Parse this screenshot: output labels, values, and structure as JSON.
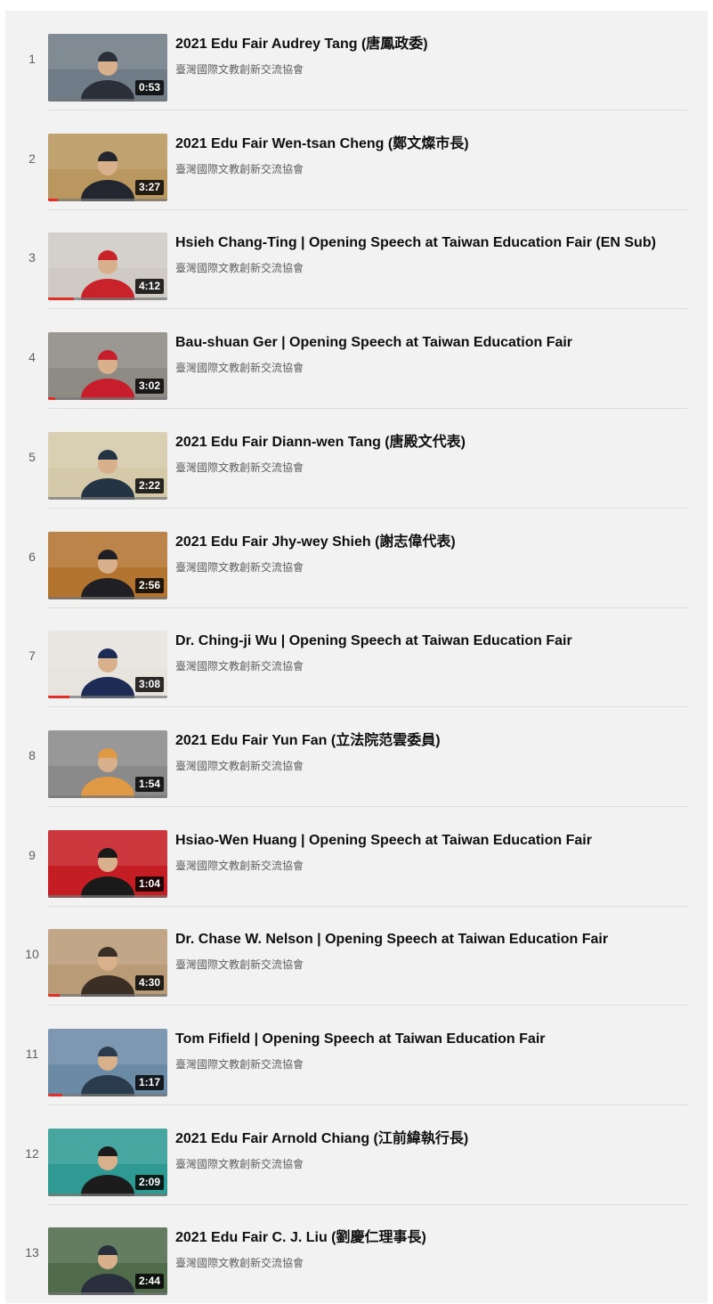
{
  "playlist": {
    "items": [
      {
        "index": "1",
        "title": "2021 Edu Fair Audrey Tang (唐鳳政委)",
        "channel": "臺灣國際文教創新交流協會",
        "duration": "0:53",
        "watched": 0.0,
        "thumb_bg": "#6f7b86",
        "thumb_accent": "#2b2f3a"
      },
      {
        "index": "2",
        "title": "2021 Edu Fair Wen-tsan Cheng (鄭文燦市長)",
        "channel": "臺灣國際文教創新交流協會",
        "duration": "3:27",
        "watched": 0.08,
        "thumb_bg": "#b9975f",
        "thumb_accent": "#23262e"
      },
      {
        "index": "3",
        "title": "Hsieh Chang-Ting | Opening Speech at Taiwan Education Fair (EN Sub)",
        "channel": "臺灣國際文教創新交流協會",
        "duration": "4:12",
        "watched": 0.22,
        "thumb_bg": "#cfcac4",
        "thumb_accent": "#c8222a"
      },
      {
        "index": "4",
        "title": "Bau-shuan Ger | Opening Speech at Taiwan Education Fair",
        "channel": "臺灣國際文教創新交流協會",
        "duration": "3:02",
        "watched": 0.06,
        "thumb_bg": "#8e8a84",
        "thumb_accent": "#c61f2b"
      },
      {
        "index": "5",
        "title": "2021 Edu Fair Diann-wen Tang (唐殿文代表)",
        "channel": "臺灣國際文教創新交流協會",
        "duration": "2:22",
        "watched": 0.0,
        "thumb_bg": "#d4c9a8",
        "thumb_accent": "#253445"
      },
      {
        "index": "6",
        "title": "2021 Edu Fair Jhy-wey Shieh (謝志偉代表)",
        "channel": "臺灣國際文教創新交流協會",
        "duration": "2:56",
        "watched": 0.0,
        "thumb_bg": "#b3742f",
        "thumb_accent": "#1f1f24"
      },
      {
        "index": "7",
        "title": "Dr. Ching-ji Wu | Opening Speech at Taiwan Education Fair",
        "channel": "臺灣國際文教創新交流協會",
        "duration": "3:08",
        "watched": 0.18,
        "thumb_bg": "#e7e4de",
        "thumb_accent": "#1d2c55"
      },
      {
        "index": "8",
        "title": "2021 Edu Fair Yun Fan (立法院范雲委員)",
        "channel": "臺灣國際文教創新交流協會",
        "duration": "1:54",
        "watched": 0.0,
        "thumb_bg": "#8a8a8a",
        "thumb_accent": "#e09a45"
      },
      {
        "index": "9",
        "title": "Hsiao-Wen Huang | Opening Speech at Taiwan Education Fair",
        "channel": "臺灣國際文教創新交流協會",
        "duration": "1:04",
        "watched": 0.0,
        "thumb_bg": "#c41d24",
        "thumb_accent": "#1a1a1a"
      },
      {
        "index": "10",
        "title": "Dr. Chase W. Nelson | Opening Speech at Taiwan Education Fair",
        "channel": "臺灣國際文教創新交流協會",
        "duration": "4:30",
        "watched": 0.1,
        "thumb_bg": "#b99b77",
        "thumb_accent": "#3b2f25"
      },
      {
        "index": "11",
        "title": "Tom Fifield | Opening Speech at Taiwan Education Fair",
        "channel": "臺灣國際文教創新交流協會",
        "duration": "1:17",
        "watched": 0.12,
        "thumb_bg": "#6b8aa6",
        "thumb_accent": "#2a3b4e"
      },
      {
        "index": "12",
        "title": "2021 Edu Fair Arnold Chiang (江前緯執行長)",
        "channel": "臺灣國際文教創新交流協會",
        "duration": "2:09",
        "watched": 0.0,
        "thumb_bg": "#2f9a93",
        "thumb_accent": "#1c1c1c"
      },
      {
        "index": "13",
        "title": "2021 Edu Fair C. J. Liu (劉慶仁理事長)",
        "channel": "臺灣國際文教創新交流協會",
        "duration": "2:44",
        "watched": 0.0,
        "thumb_bg": "#4f6b4a",
        "thumb_accent": "#2a2f3d"
      }
    ]
  }
}
